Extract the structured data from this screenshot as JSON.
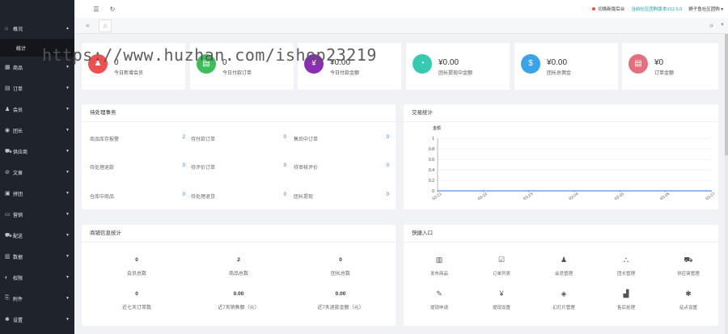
{
  "watermark": "https://www.huzhan.com/ishop23219",
  "sidebar": {
    "items": [
      {
        "label": "概况",
        "icon": "home-icon",
        "glyph": "⌂",
        "arrow": "▲"
      },
      {
        "label": "商品",
        "icon": "goods-icon",
        "glyph": "▦",
        "arrow": "▼"
      },
      {
        "label": "订单",
        "icon": "order-icon",
        "glyph": "▤",
        "arrow": "▼"
      },
      {
        "label": "会员",
        "icon": "member-icon",
        "glyph": "♟",
        "arrow": "▼"
      },
      {
        "label": "团长",
        "icon": "leader-icon",
        "glyph": "◉",
        "arrow": "▼"
      },
      {
        "label": "供应商",
        "icon": "supplier-icon",
        "glyph": "⛟",
        "arrow": "▼"
      },
      {
        "label": "文章",
        "icon": "article-icon",
        "glyph": "⊘",
        "arrow": "▼"
      },
      {
        "label": "拼团",
        "icon": "group-buy-icon",
        "glyph": "▣",
        "arrow": "▼"
      },
      {
        "label": "营销",
        "icon": "marketing-icon",
        "glyph": "▭",
        "arrow": "▼"
      },
      {
        "label": "配送",
        "icon": "delivery-icon",
        "glyph": "⛟",
        "arrow": "▼"
      },
      {
        "label": "数据",
        "icon": "data-icon",
        "glyph": "▥",
        "arrow": "▼"
      },
      {
        "label": "权限",
        "icon": "permission-icon",
        "glyph": "◐",
        "arrow": "▼"
      },
      {
        "label": "附件",
        "icon": "attachment-icon",
        "glyph": "⎘",
        "arrow": "▼"
      },
      {
        "label": "设置",
        "icon": "settings-icon",
        "glyph": "✱",
        "arrow": "▼"
      }
    ],
    "sub_item": "统计"
  },
  "topbar": {
    "menu_glyph": "☰",
    "refresh_glyph": "↻",
    "switch_label": "切换新版后台",
    "version_label": "当前社区团购版本V12.5.0",
    "user_label": "狮子鱼社区团购 ▾"
  },
  "tabbar": {
    "left": "«",
    "home": "⌂",
    "right": "»",
    "dd": "▼"
  },
  "stats": [
    {
      "value": "0",
      "label": "今日新增会员",
      "color": "#ee4f4f",
      "icon": "new-member-icon",
      "glyph": "♟"
    },
    {
      "value": "0",
      "label": "今日付款订单",
      "color": "#3cbf5b",
      "icon": "paid-order-icon",
      "glyph": "▤"
    },
    {
      "value": "¥0.00",
      "label": "今日付款金额",
      "color": "#8a2fb4",
      "icon": "paid-amount-icon",
      "glyph": "¥"
    },
    {
      "value": "¥0.00",
      "label": "团长提现中金额",
      "color": "#35cbb3",
      "icon": "withdraw-pie-icon",
      "glyph": "◔"
    },
    {
      "value": "¥0.00",
      "label": "团长总佣金",
      "color": "#3aa4e8",
      "icon": "money-bag-icon",
      "glyph": "$"
    },
    {
      "value": "¥0",
      "label": "订单金额",
      "color": "#e56f7c",
      "icon": "order-amount-icon",
      "glyph": "▤"
    }
  ],
  "todo": {
    "title": "待处理事务",
    "rows": [
      [
        {
          "label": "商品库存报警",
          "value": "2",
          "blue": true
        },
        {
          "label": "待付款订单",
          "value": "0",
          "blue": false
        },
        {
          "label": "售后中订单",
          "value": "0",
          "blue": true
        }
      ],
      [
        {
          "label": "待处理退款",
          "value": "0",
          "blue": true
        },
        {
          "label": "待评价订单",
          "value": "0",
          "blue": false
        },
        {
          "label": "待审核评价",
          "value": "0",
          "blue": true
        }
      ],
      [
        {
          "label": "仓库中商品",
          "value": "0",
          "blue": true
        },
        {
          "label": "待处理退货",
          "value": "0",
          "blue": false
        },
        {
          "label": "团长提现",
          "value": "0",
          "blue": false
        }
      ]
    ]
  },
  "trade": {
    "title": "交易统计",
    "unit": "金额"
  },
  "chart_data": {
    "type": "line",
    "title": "",
    "ylabel": "金额",
    "xlabel": "",
    "categories": [
      "03-21",
      "03-22",
      "03-23",
      "03-24",
      "03-25",
      "03-26",
      "03-27"
    ],
    "values": [
      0,
      0,
      0,
      0,
      0,
      0,
      0
    ],
    "yticks": [
      "0",
      "0.2",
      "0.4",
      "0.6",
      "0.8",
      "1"
    ],
    "ylim": [
      0,
      1
    ],
    "grid": true,
    "line_color": "#5b8def"
  },
  "shop": {
    "title": "商铺信息统计",
    "cells": [
      {
        "value": "0",
        "label": "会员总数"
      },
      {
        "value": "2",
        "label": "商品总数"
      },
      {
        "value": "0",
        "label": "团长总数"
      },
      {
        "value": "0",
        "label": "近七天订单数"
      },
      {
        "value": "0.00",
        "label": "近7天销售额（元）"
      },
      {
        "value": "0.00",
        "label": "近7天退款金额（元）"
      }
    ]
  },
  "quick": {
    "title": "快捷入口",
    "items": [
      {
        "label": "发布商品",
        "icon": "publish-goods-icon",
        "glyph": "▥"
      },
      {
        "label": "订单列表",
        "icon": "order-list-icon",
        "glyph": "☑"
      },
      {
        "label": "会员管理",
        "icon": "member-manage-icon",
        "glyph": "♟"
      },
      {
        "label": "团长管理",
        "icon": "leader-manage-icon",
        "glyph": "⛬"
      },
      {
        "label": "供应商管理",
        "icon": "supplier-manage-icon",
        "glyph": "⛟"
      },
      {
        "label": "提现申请",
        "icon": "withdraw-apply-icon",
        "glyph": "✎"
      },
      {
        "label": "提现设置",
        "icon": "withdraw-setting-icon",
        "glyph": "¥"
      },
      {
        "label": "幻灯片管理",
        "icon": "slide-manage-icon",
        "glyph": "◈"
      },
      {
        "label": "售后处理",
        "icon": "after-sale-icon",
        "glyph": "▟"
      },
      {
        "label": "站点设置",
        "icon": "site-setting-icon",
        "glyph": "✱"
      }
    ]
  }
}
